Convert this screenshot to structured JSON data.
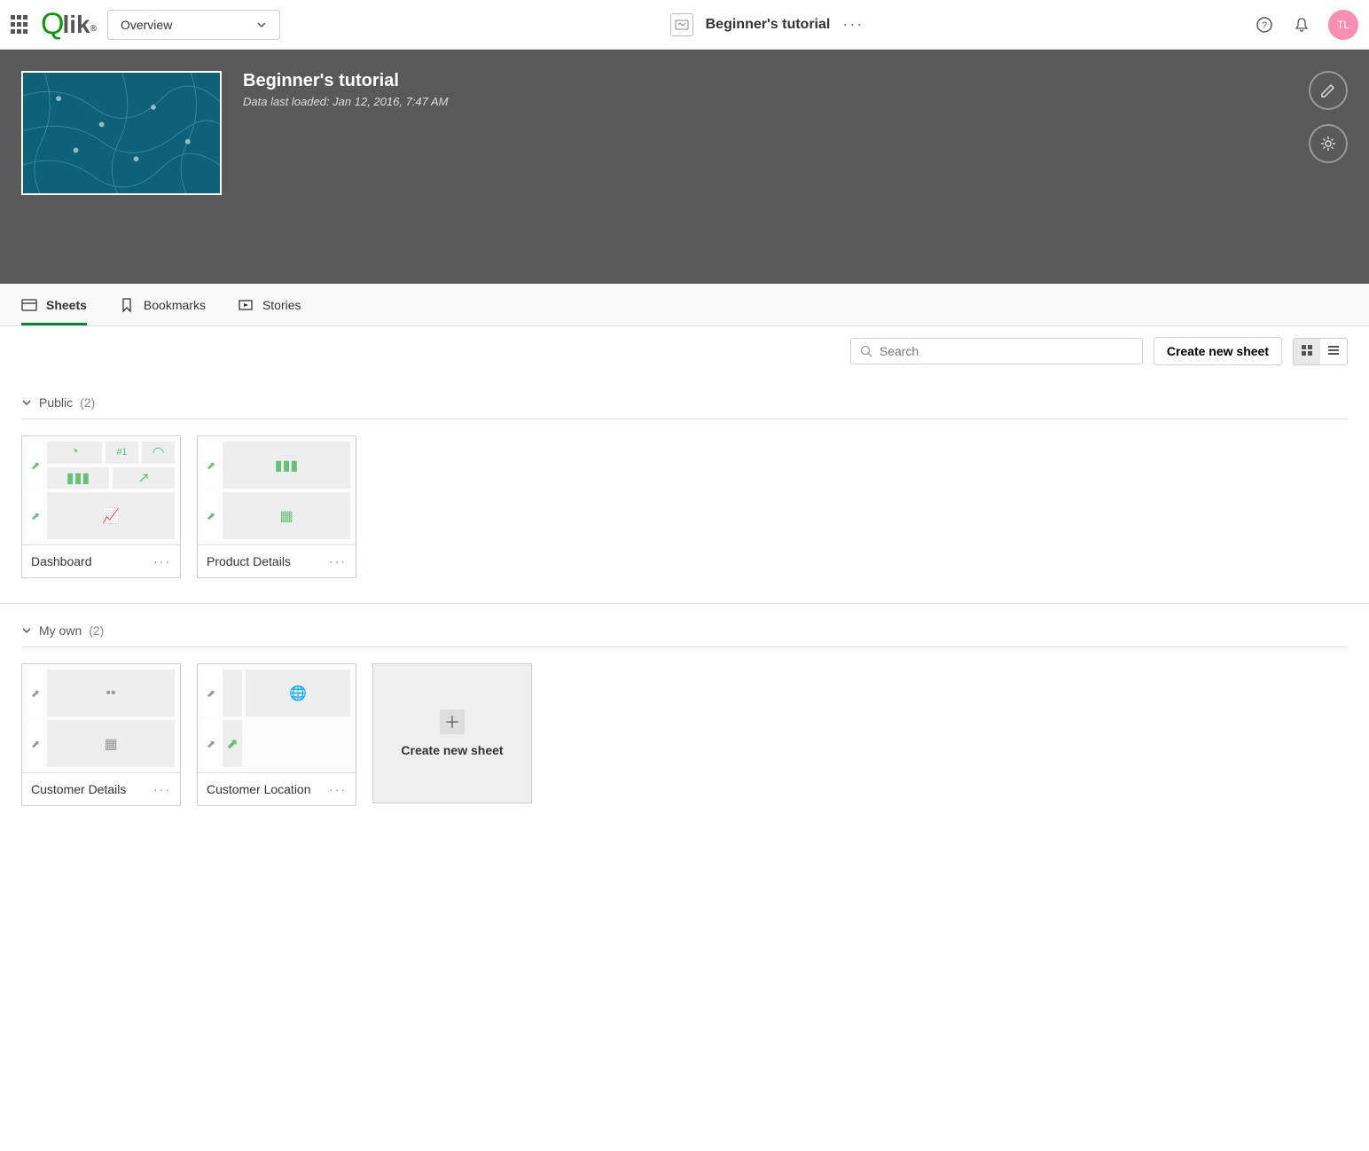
{
  "header": {
    "dropdown_label": "Overview",
    "app_title": "Beginner's tutorial",
    "avatar_initials": "TL"
  },
  "hero": {
    "title": "Beginner's tutorial",
    "meta": "Data last loaded: Jan 12, 2016, 7:47 AM"
  },
  "tabs": {
    "sheets": "Sheets",
    "bookmarks": "Bookmarks",
    "stories": "Stories"
  },
  "toolbar": {
    "search_placeholder": "Search",
    "create_label": "Create new sheet"
  },
  "sections": {
    "public": {
      "label": "Public",
      "count": "(2)"
    },
    "myown": {
      "label": "My own",
      "count": "(2)"
    }
  },
  "cards": {
    "dashboard": "Dashboard",
    "product_details": "Product Details",
    "customer_details": "Customer Details",
    "customer_location": "Customer Location",
    "hash1": "#1"
  },
  "create_card": {
    "label": "Create new sheet"
  }
}
